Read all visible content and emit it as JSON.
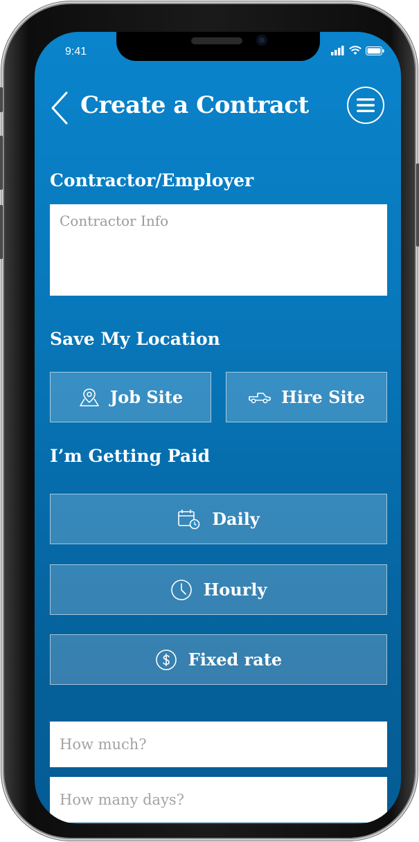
{
  "status_bar": {
    "time": "9:41"
  },
  "header": {
    "title": "Create a Contract"
  },
  "contractor": {
    "label": "Contractor/Employer",
    "placeholder": "Contractor Info"
  },
  "location": {
    "label": "Save My Location",
    "buttons": [
      {
        "label": "Job Site",
        "icon": "map-pin-icon"
      },
      {
        "label": "Hire Site",
        "icon": "truck-icon"
      }
    ]
  },
  "payment": {
    "label": "I’m Getting Paid",
    "options": [
      {
        "label": "Daily",
        "icon": "calendar-clock-icon"
      },
      {
        "label": "Hourly",
        "icon": "clock-icon"
      },
      {
        "label": "Fixed rate",
        "icon": "dollar-icon"
      }
    ]
  },
  "fields": {
    "how_much_placeholder": "How much?",
    "how_many_days_placeholder": "How many days?"
  },
  "colors": {
    "gradient_top": "#0a84cc",
    "gradient_bottom": "#055c95",
    "button_fill": "rgba(255,255,255,0.2)",
    "text": "#ffffff",
    "placeholder": "#9a9a9a"
  }
}
